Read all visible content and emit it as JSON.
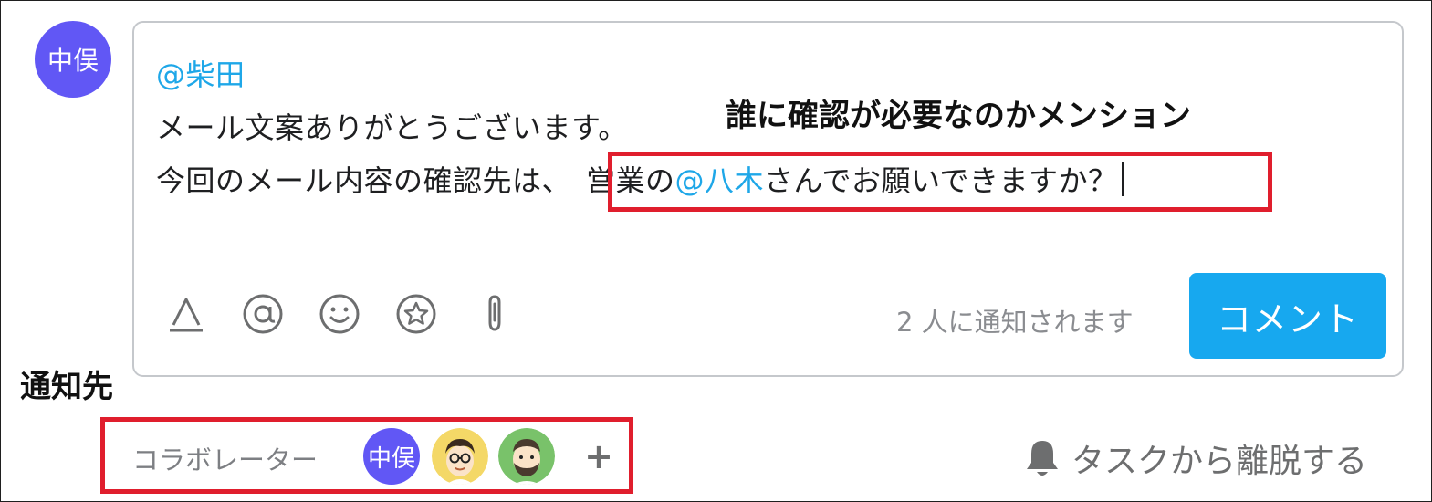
{
  "author_avatar": {
    "initials": "中俣",
    "color": "#6157f5"
  },
  "comment": {
    "mention_line": "@柴田",
    "line1": "メール文案ありがとうございます。",
    "line2_prefix": "今回のメール内容の確認先は、",
    "line2_before_mention": "営業の",
    "line2_mention": "@八木",
    "line2_suffix": "さんでお願いできますか？"
  },
  "annotations": {
    "mention_note": "誰に確認が必要なのかメンション",
    "notify_target": "通知先"
  },
  "toolbar": {
    "icons": [
      "text-format-icon",
      "mention-icon",
      "emoji-icon",
      "star-icon",
      "paperclip-icon"
    ],
    "notify_text": "2 人に通知されます",
    "comment_button": "コメント"
  },
  "collaborators": {
    "label": "コラボレーター",
    "members": [
      {
        "initials": "中俣",
        "color": "#6157f5"
      },
      {
        "type": "photo",
        "color": "#f4d867"
      },
      {
        "type": "photo",
        "color": "#79c26a"
      }
    ],
    "add": "+"
  },
  "leave_task": {
    "label": "タスクから離脱する"
  },
  "colors": {
    "accent": "#17a8ef",
    "mention": "#1ea7e8",
    "highlight": "#e01e2d"
  }
}
